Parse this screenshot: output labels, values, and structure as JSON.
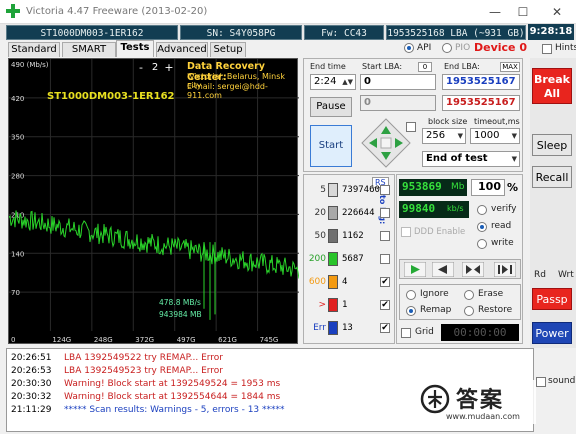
{
  "window": {
    "title": "Victoria 4.47   Freeware (2013-02-20)",
    "minimize": "—",
    "maximize": "☐",
    "close": "✕"
  },
  "infobar": {
    "model": "ST1000DM003-1ER162",
    "serial": "SN: S4Y058PG",
    "firmware": "Fw: CC43",
    "capacity": "1953525168 LBA (~931 GB)",
    "clock": "9:28:18"
  },
  "tabs": [
    "Standard",
    "SMART",
    "Tests",
    "Advanced",
    "Setup"
  ],
  "active_tab": "Tests",
  "mode": {
    "api": "API",
    "pio": "PIO",
    "device": "Device 0",
    "hints": "Hints"
  },
  "chart": {
    "unit": "490 (Mb/s)",
    "y_ticks": [
      "420",
      "350",
      "280",
      "210",
      "140",
      "70"
    ],
    "x_ticks": [
      "0",
      "124G",
      "248G",
      "372G",
      "497G",
      "621G",
      "745G",
      "869G"
    ],
    "model_label": "ST1000DM003-1ER162",
    "speed_readout": "478.8 MB/s",
    "kb_readout": "943984 MB",
    "page_minus": "-",
    "page_num": "2",
    "page_plus": "+",
    "ad_line1": "Data Recovery Center:",
    "ad_line2": "'Victoria', Belarus, Minsk city",
    "ad_line3": "E-mail: sergei@hdd-911.com"
  },
  "controls": {
    "end_time_label": "End time",
    "end_time_value": "2:24",
    "start_lba_label": "Start LBA:",
    "start_lba_counter": "0",
    "start_lba_value": "0",
    "start_lba_value2": "0",
    "end_lba_label": "End LBA:",
    "end_lba_max": "MAX",
    "end_lba_value": "1953525167",
    "end_lba_value2": "1953525167",
    "pause_label": "Pause",
    "start_label": "Start",
    "block_size_label": "block size",
    "block_size_value": "256",
    "timeout_label": "timeout,ms",
    "timeout_value": "1000",
    "end_action": "End of test"
  },
  "counters": {
    "rs_label": "RS",
    "to_log_label": "to log:",
    "rows": [
      {
        "label": "5",
        "value": "7397460",
        "color": "#d8d8d8",
        "checked": false
      },
      {
        "label": "20",
        "value": "226644",
        "color": "#a8a8a8",
        "checked": false
      },
      {
        "label": "50",
        "value": "1162",
        "color": "#707070",
        "checked": false
      },
      {
        "label": "200",
        "value": "5687",
        "color": "#29c42a",
        "checked": false
      },
      {
        "label": "600",
        "value": "4",
        "color": "#f39a12",
        "checked": true
      },
      {
        "label": ">",
        "value": "1",
        "color": "#e02020",
        "checked": true
      },
      {
        "label": "Err",
        "value": "13",
        "color": "#1a3fbf",
        "checked": true
      }
    ]
  },
  "stats": {
    "mb_value": "953869",
    "mb_unit": "Mb",
    "percent": "100",
    "percent_unit": "%",
    "kbs_value": "99840",
    "kbs_unit": "kb/s",
    "ddd_enable": "DDD Enable",
    "verify": "verify",
    "read": "read",
    "write": "write",
    "ignore": "Ignore",
    "erase": "Erase",
    "remap": "Remap",
    "restore": "Restore",
    "grid": "Grid",
    "timer": "00:00:00"
  },
  "side": {
    "break_line1": "Break",
    "break_line2": "All",
    "sleep": "Sleep",
    "recall": "Recall",
    "rd": "Rd",
    "wrt": "Wrt",
    "passp": "Passp",
    "power": "Power",
    "sound": "sound"
  },
  "log": [
    {
      "time": "20:26:51",
      "msg": "LBA 1392549522 try REMAP... Error",
      "color": "#c81e1e"
    },
    {
      "time": "20:26:53",
      "msg": "LBA 1392549523 try REMAP... Error",
      "color": "#c81e1e"
    },
    {
      "time": "20:30:30",
      "msg": "Warning! Block start at 1392549524 = 1953 ms",
      "color": "#c81e1e"
    },
    {
      "time": "20:30:32",
      "msg": "Warning! Block start at 1392554644 = 1844 ms",
      "color": "#c81e1e"
    },
    {
      "time": "21:11:29",
      "msg": "***** Scan results: Warnings - 5, errors - 13 *****",
      "color": "#1a3fbf"
    }
  ],
  "watermark": {
    "site": "www.mudaan.com",
    "cn": "答案"
  },
  "colors": {
    "chart_line": "#2ad42a",
    "chart_grid": "#2a2a2a",
    "dark_field": "#123d52",
    "break_red": "#e8251e"
  }
}
